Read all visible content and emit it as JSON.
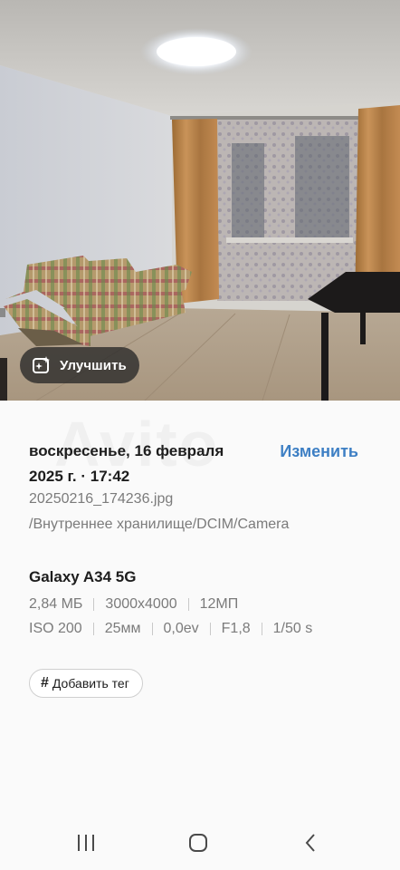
{
  "photo": {
    "enhance_label": "Улучшить",
    "enhance_icon": "sparkle-image-icon",
    "watermark": "Avito"
  },
  "details": {
    "date_line1": "воскресенье, 16 февраля",
    "date_line2": "2025 г. · 17:42",
    "edit_label": "Изменить",
    "filename": "20250216_174236.jpg",
    "path": "/Внутреннее хранилище/DCIM/Camera",
    "device": "Galaxy A34 5G",
    "meta_row1": [
      "2,84 МБ",
      "3000x4000",
      "12МП"
    ],
    "meta_row2": [
      "ISO 200",
      "25мм",
      "0,0ev",
      "F1,8",
      "1/50 s"
    ],
    "tag_label": "Добавить тег"
  },
  "nav": {
    "recent": "recent-apps-icon",
    "home": "home-icon",
    "back": "back-icon"
  },
  "colors": {
    "accent": "#3d7fc4",
    "secondary_text": "#7b7b7b",
    "background": "#fafafa"
  }
}
